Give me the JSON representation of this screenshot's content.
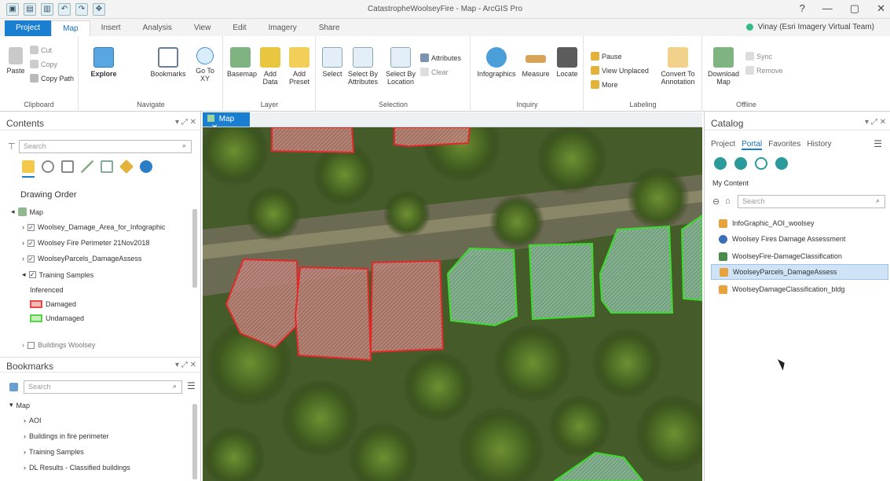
{
  "window": {
    "title": "CatastropheWoolseyFire - Map - ArcGIS Pro",
    "controls": [
      "?",
      "—",
      "▢",
      "✕"
    ]
  },
  "ribbon_tabs": [
    {
      "label": "Project"
    },
    {
      "label": "Map"
    },
    {
      "label": "Insert"
    },
    {
      "label": "Analysis"
    },
    {
      "label": "View"
    },
    {
      "label": "Edit"
    },
    {
      "label": "Imagery"
    },
    {
      "label": "Share"
    }
  ],
  "user": {
    "label": "Vinay (Esri Imagery Virtual Team)"
  },
  "ribbon": {
    "clipboard": {
      "name": "Clipboard",
      "paste": "Paste",
      "cut": "Cut",
      "copy": "Copy",
      "copy_path": "Copy Path"
    },
    "navigate": {
      "name": "Navigate",
      "explore": "Explore",
      "bookmarks": "Bookmarks",
      "go_to_xy": "Go To XY"
    },
    "layer": {
      "name": "Layer",
      "basemap": "Basemap",
      "add_data": "Add Data",
      "add_preset": "Add Preset"
    },
    "selection": {
      "name": "Selection",
      "select": "Select",
      "select_by_attributes": "Select By Attributes",
      "select_by_location": "Select By Location",
      "attributes": "Attributes",
      "clear": "Clear"
    },
    "inquiry": {
      "name": "Inquiry",
      "infographics": "Infographics",
      "measure": "Measure",
      "locate": "Locate"
    },
    "labeling": {
      "name": "Labeling",
      "pause": "Pause",
      "view_unplaced": "View Unplaced",
      "more": "More",
      "convert_to_annotation": "Convert To Annotation"
    },
    "offline": {
      "name": "Offline",
      "download_map": "Download Map",
      "sync": "Sync",
      "remove": "Remove"
    }
  },
  "contents": {
    "title": "Contents",
    "search_placeholder": "Search",
    "drawing_order": "Drawing Order",
    "map_label": "Map",
    "layers": [
      {
        "label": "Woolsey_Damage_Area_for_Infographic",
        "checked": true
      },
      {
        "label": "Woolsey Fire Perimeter 21Nov2018",
        "checked": true
      },
      {
        "label": "WoolseyParcels_DamageAssess",
        "checked": true
      },
      {
        "label": "Training Samples",
        "checked": true
      }
    ],
    "legend_heading": "Inferenced",
    "legend": [
      {
        "label": "Damaged",
        "color": "#e84a4a"
      },
      {
        "label": "Undamaged",
        "color": "#59d34a"
      }
    ],
    "buildings_layer": "Buildings Woolsey"
  },
  "bookmarks": {
    "title": "Bookmarks",
    "search_placeholder": "Search",
    "map_label": "Map",
    "items": [
      {
        "label": "AOI"
      },
      {
        "label": "Buildings in fire perimeter"
      },
      {
        "label": "Training Samples"
      },
      {
        "label": "DL Results - Classified buildings"
      }
    ]
  },
  "map": {
    "tab_label": "Map"
  },
  "catalog": {
    "title": "Catalog",
    "tabs": [
      {
        "label": "Project",
        "active": false
      },
      {
        "label": "Portal",
        "active": true
      },
      {
        "label": "Favorites",
        "active": false
      },
      {
        "label": "History",
        "active": false
      }
    ],
    "section": "My Content",
    "search_placeholder": "Search",
    "items": [
      {
        "label": "InfoGraphic_AOI_woolsey",
        "icon_color": "#e6a23c",
        "selected": false
      },
      {
        "label": "Woolsey Fires Damage Assessment",
        "icon_color": "#3a6fb7",
        "selected": false
      },
      {
        "label": "WoolseyFire-DamageClassification",
        "icon_color": "#4a8a4a",
        "selected": false
      },
      {
        "label": "WoolseyParcels_DamageAssess",
        "icon_color": "#e6a23c",
        "selected": true
      },
      {
        "label": "WoolseyDamageClassification_bldg",
        "icon_color": "#e6a23c",
        "selected": false
      }
    ]
  },
  "colors": {
    "accent": "#1a7fd1",
    "damaged": "#e84a4a",
    "undamaged": "#59d34a"
  }
}
